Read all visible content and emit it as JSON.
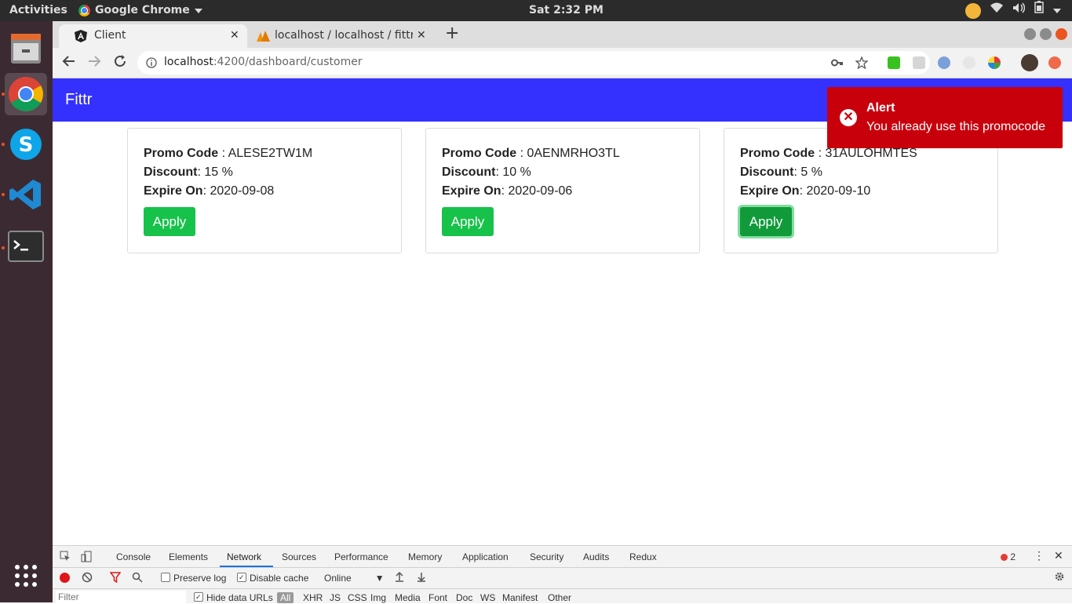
{
  "ubuntu": {
    "activities": "Activities",
    "app_menu": "Google Chrome",
    "clock": "Sat  2:32 PM"
  },
  "browser": {
    "tabs": [
      {
        "title": "Client",
        "icon": "angular-icon",
        "active": true
      },
      {
        "title": "localhost / localhost / fittr",
        "icon": "phpmyadmin-icon",
        "active": false
      }
    ],
    "url_host": "localhost",
    "url_rest": ":4200/dashboard/customer"
  },
  "app": {
    "brand": "Fittr",
    "header_color": "#3431ff",
    "promos": [
      {
        "code_label": "Promo Code",
        "code": "ALESE2TW1M",
        "discount_label": "Discount",
        "discount": "15 %",
        "expire_label": "Expire On",
        "expire": "2020-09-08",
        "button": "Apply"
      },
      {
        "code_label": "Promo Code",
        "code": "0AENMRHO3TL",
        "discount_label": "Discount",
        "discount": "10 %",
        "expire_label": "Expire On",
        "expire": "2020-09-06",
        "button": "Apply"
      },
      {
        "code_label": "Promo Code",
        "code": "31AULOHMTES",
        "discount_label": "Discount",
        "discount": "5 %",
        "expire_label": "Expire On",
        "expire": "2020-09-10",
        "button": "Apply"
      }
    ]
  },
  "toast": {
    "title": "Alert",
    "message": "You already use this promocode",
    "color": "#c8000c"
  },
  "devtools": {
    "tabs": [
      "Console",
      "Elements",
      "Network",
      "Sources",
      "Performance",
      "Memory",
      "Application",
      "Security",
      "Audits",
      "Redux"
    ],
    "active_tab": "Network",
    "error_count": "2",
    "preserve_log": "Preserve log",
    "disable_cache": "Disable cache",
    "throttle": "Online",
    "filter_placeholder": "Filter",
    "hide_data_urls": "Hide data URLs",
    "types": [
      "All",
      "XHR",
      "JS",
      "CSS",
      "Img",
      "Media",
      "Font",
      "Doc",
      "WS",
      "Manifest",
      "Other"
    ]
  }
}
